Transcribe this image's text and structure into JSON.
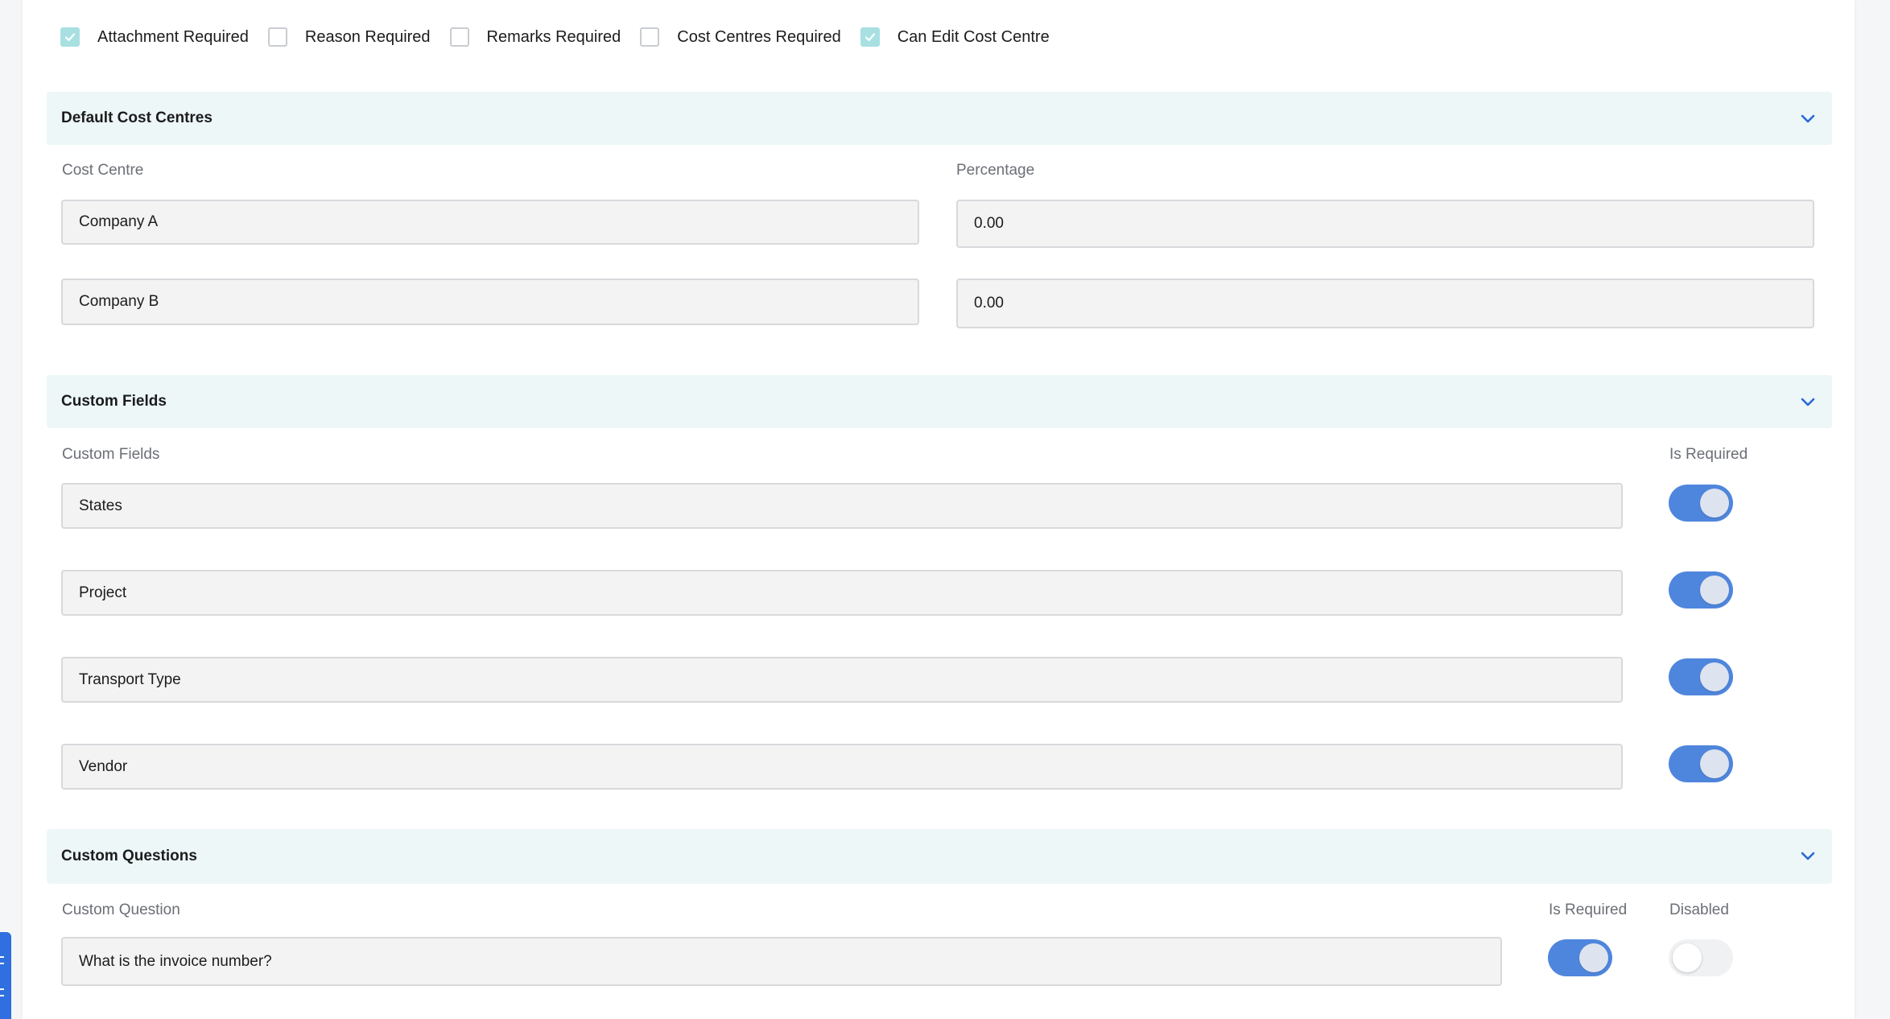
{
  "checkboxes": [
    {
      "label": "Attachment Required",
      "checked": true
    },
    {
      "label": "Reason Required",
      "checked": false
    },
    {
      "label": "Remarks Required",
      "checked": false
    },
    {
      "label": "Cost Centres Required",
      "checked": false
    },
    {
      "label": "Can Edit Cost Centre",
      "checked": true
    }
  ],
  "cost_centres": {
    "title": "Default Cost Centres",
    "col_cost_centre": "Cost Centre",
    "col_percentage": "Percentage",
    "rows": [
      {
        "name": "Company A",
        "percentage": "0.00"
      },
      {
        "name": "Company B",
        "percentage": "0.00"
      }
    ]
  },
  "custom_fields": {
    "title": "Custom Fields",
    "col_field": "Custom Fields",
    "col_required": "Is Required",
    "rows": [
      {
        "name": "States",
        "required": true
      },
      {
        "name": "Project",
        "required": true
      },
      {
        "name": "Transport Type",
        "required": true
      },
      {
        "name": "Vendor",
        "required": true
      }
    ]
  },
  "custom_questions": {
    "title": "Custom Questions",
    "col_question": "Custom Question",
    "col_required": "Is Required",
    "col_disabled": "Disabled",
    "rows": [
      {
        "question": "What is the invoice number?",
        "required": true,
        "disabled": false
      }
    ]
  },
  "colors": {
    "accent": "#4f86dd",
    "section_bg": "#edf7f8",
    "checkbox_checked": "#a8e0e2"
  },
  "icons": {
    "section_toggle": "chevron-down-icon",
    "checkbox": "check-icon"
  }
}
